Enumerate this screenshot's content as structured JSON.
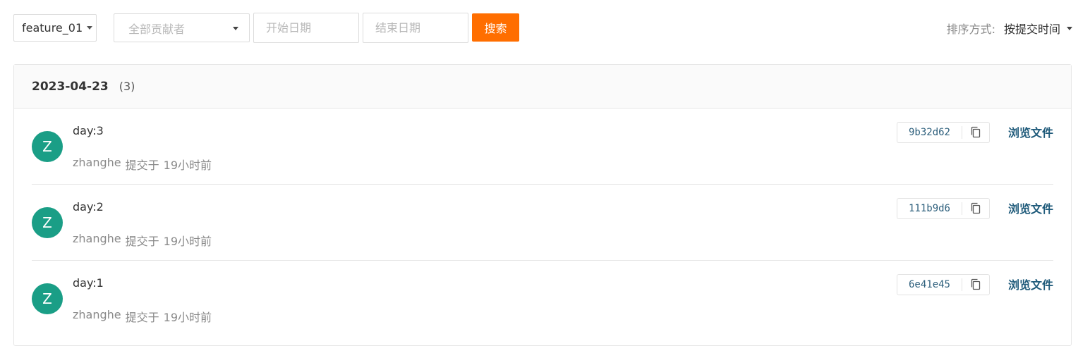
{
  "filters": {
    "branch": "feature_01",
    "contributor_placeholder": "全部贡献者",
    "start_date_placeholder": "开始日期",
    "end_date_placeholder": "结束日期",
    "search_label": "搜索"
  },
  "sort": {
    "label": "排序方式:",
    "value": "按提交时间"
  },
  "group": {
    "date": "2023-04-23",
    "count": "(3)"
  },
  "commits": [
    {
      "avatar_letter": "Z",
      "message": "day:3",
      "author": "zhanghe",
      "action": "提交于",
      "time": "19小时前",
      "sha": "9b32d62",
      "browse_label": "浏览文件"
    },
    {
      "avatar_letter": "Z",
      "message": "day:2",
      "author": "zhanghe",
      "action": "提交于",
      "time": "19小时前",
      "sha": "111b9d6",
      "browse_label": "浏览文件"
    },
    {
      "avatar_letter": "Z",
      "message": "day:1",
      "author": "zhanghe",
      "action": "提交于",
      "time": "19小时前",
      "sha": "6e41e45",
      "browse_label": "浏览文件"
    }
  ],
  "colors": {
    "search_button": "#ff6e00",
    "avatar": "#1a9e86",
    "link": "#1e5a7a"
  },
  "icons": {
    "copy": "copy-icon",
    "dropdown": "caret-down-icon"
  }
}
